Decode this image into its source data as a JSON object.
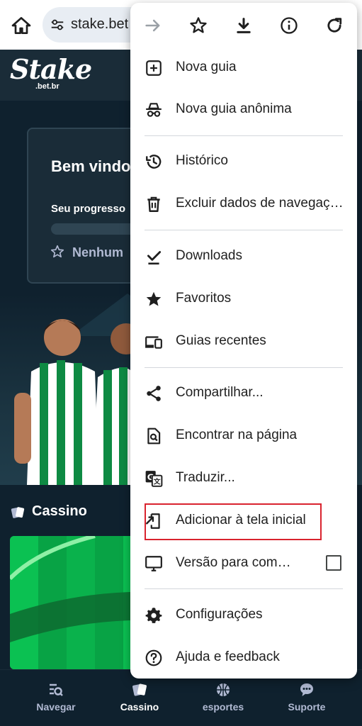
{
  "browser": {
    "url": "stake.bet"
  },
  "site": {
    "logo_text": "Stake",
    "logo_sub": ".bet.br",
    "welcome_title": "Bem vindo",
    "progress_label": "Seu progresso",
    "vip_level": "Nenhum",
    "casino_label": "Cassino"
  },
  "bottom_nav": [
    {
      "label": "Navegar",
      "icon": "browse-icon",
      "active": false
    },
    {
      "label": "Cassino",
      "icon": "cards-icon",
      "active": true
    },
    {
      "label": "esportes",
      "icon": "basketball-icon",
      "active": false
    },
    {
      "label": "Suporte",
      "icon": "chat-icon",
      "active": false
    }
  ],
  "menu": {
    "top_icons": [
      "forward-icon",
      "star-icon",
      "download-icon",
      "info-icon",
      "refresh-icon"
    ],
    "items": [
      {
        "label": "Nova guia",
        "icon": "plus-box-icon"
      },
      {
        "label": "Nova guia anônima",
        "icon": "incognito-icon"
      },
      {
        "label": "Histórico",
        "icon": "history-icon"
      },
      {
        "label": "Excluir dados de navegação",
        "icon": "trash-icon"
      },
      {
        "label": "Downloads",
        "icon": "download-done-icon"
      },
      {
        "label": "Favoritos",
        "icon": "star-filled-icon"
      },
      {
        "label": "Guias recentes",
        "icon": "devices-icon"
      },
      {
        "label": "Compartilhar...",
        "icon": "share-icon"
      },
      {
        "label": "Encontrar na página",
        "icon": "find-in-page-icon"
      },
      {
        "label": "Traduzir...",
        "icon": "translate-icon"
      },
      {
        "label": "Adicionar à tela inicial",
        "icon": "add-to-home-icon"
      },
      {
        "label": "Versão para computador",
        "icon": "desktop-icon"
      },
      {
        "label": "Configurações",
        "icon": "settings-icon"
      },
      {
        "label": "Ajuda e feedback",
        "icon": "help-icon"
      }
    ]
  },
  "colors": {
    "site_bg": "#0f212e",
    "site_header_bg": "#1a2c38",
    "highlight": "#d9232e",
    "menu_bg": "#ffffff"
  }
}
